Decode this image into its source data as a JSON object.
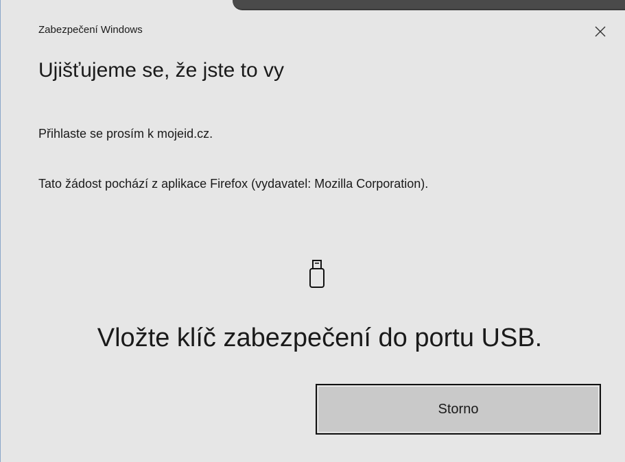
{
  "window": {
    "title": "Zabezpečení Windows",
    "close_icon": "close-icon"
  },
  "main": {
    "heading": "Ujišťujeme se, že jste to vy",
    "sign_in_text": "Přihlaste se prosím k mojeid.cz.",
    "request_text": "Tato žádost pochází z aplikace Firefox (vydavatel: Mozilla Corporation).",
    "device_icon": "usb-key-icon",
    "instruction": "Vložte klíč zabezpečení do portu USB."
  },
  "buttons": {
    "cancel_label": "Storno"
  }
}
